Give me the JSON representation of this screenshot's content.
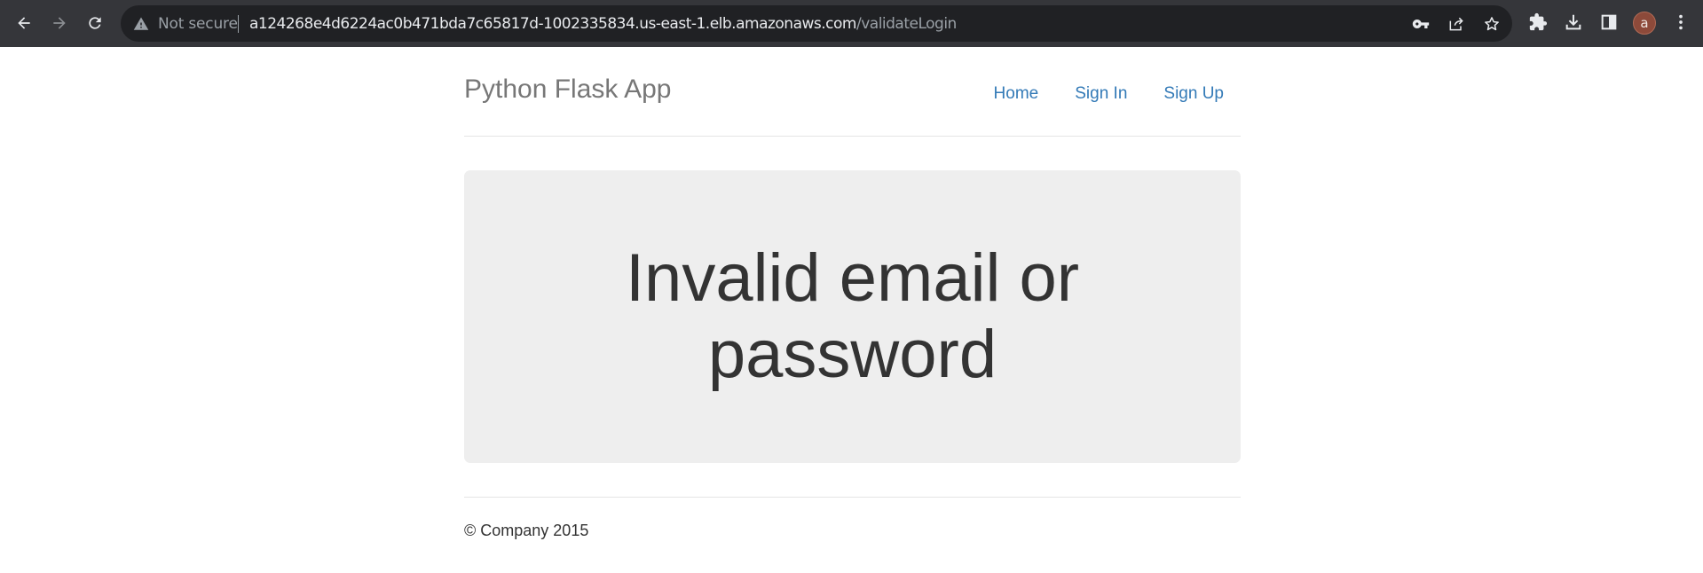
{
  "browser": {
    "security_label": "Not secure",
    "url_host": "a124268e4d6224ac0b471bda7c65817d-1002335834.us-east-1.elb.amazonaws.com",
    "url_path": "/validateLogin",
    "profile_initial": "a",
    "icons": [
      "back-icon",
      "forward-icon",
      "reload-icon",
      "warning-icon",
      "key-icon",
      "share-icon",
      "star-icon",
      "extensions-icon",
      "download-icon",
      "side-panel-icon",
      "menu-icon"
    ]
  },
  "header": {
    "brand": "Python Flask App",
    "nav": [
      {
        "label": "Home"
      },
      {
        "label": "Sign In"
      },
      {
        "label": "Sign Up"
      }
    ]
  },
  "main": {
    "message": "Invalid email or password"
  },
  "footer": {
    "text": "© Company 2015"
  },
  "colors": {
    "chrome_bg": "#35363a",
    "omnibox_bg": "#202124",
    "link": "#337ab7",
    "jumbotron_bg": "#eeeeee",
    "brand_text": "#777777"
  }
}
